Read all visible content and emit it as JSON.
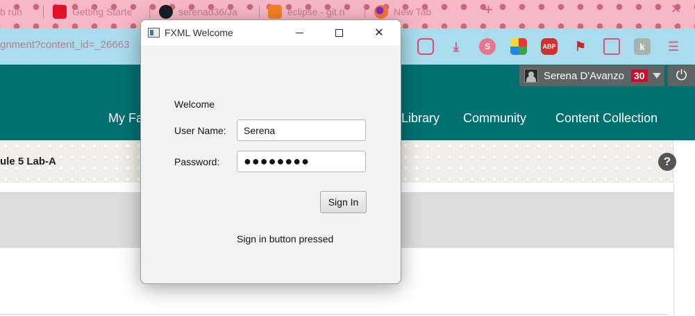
{
  "browser": {
    "tabs": [
      {
        "label": "b run",
        "icon": "tab-favicon"
      },
      {
        "label": "Getting Starte",
        "icon": "oracle-icon"
      },
      {
        "label": "serenad36/Ja",
        "icon": "github-icon"
      },
      {
        "label": "eclipse - git n",
        "icon": "stackoverflow-icon"
      },
      {
        "label": "New Tab",
        "icon": "firefox-icon"
      }
    ],
    "new_tab": "+",
    "address": "gnment?content_id=_26663",
    "extensions": [
      "pocket-icon",
      "download-icon",
      "s-extension-icon",
      "colorful-extension-icon",
      "adblock-plus-icon",
      "flag-extension-icon",
      "screenshot-extension-icon",
      "k-extension-icon",
      "menu-icon"
    ],
    "adblock_label": "ABP",
    "s_label": "S",
    "k_label": "k",
    "menu_glyph": "☰"
  },
  "header": {
    "user_name": "Serena D'Avanzo",
    "notification_count": "30",
    "nav": [
      "My Fa",
      "Library",
      "Community",
      "Content Collection"
    ]
  },
  "breadcrumb": {
    "title": "ule 5 Lab-A",
    "help": "?"
  },
  "dialog": {
    "title": "FXML Welcome",
    "welcome": "Welcome",
    "username_label": "User Name:",
    "username_value": "Serena",
    "password_label": "Password:",
    "password_value": "●●●●●●●●",
    "signin_button": "Sign In",
    "status": "Sign in button pressed",
    "close_glyph": "✕"
  },
  "colors": {
    "tabstrip": "#f6b8c4",
    "navbar": "#a9dcec",
    "header": "#007070",
    "badge": "#c8102e"
  }
}
